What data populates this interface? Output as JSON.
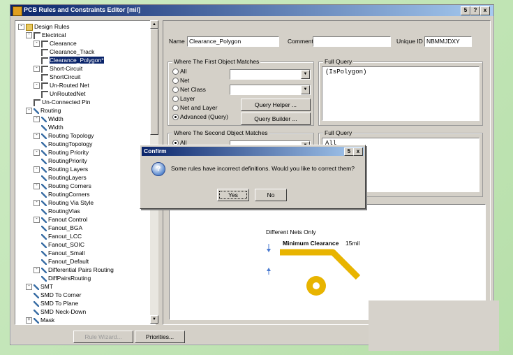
{
  "window": {
    "title": "PCB Rules and Constraints Editor [mil]",
    "btn_help": "?",
    "btn_close": "x",
    "btn_menu": "5"
  },
  "tree": {
    "items": [
      {
        "label": "Design Rules",
        "indent": 0,
        "exp": "-",
        "icon": "folder"
      },
      {
        "label": "Electrical",
        "indent": 1,
        "exp": "-",
        "icon": "rule"
      },
      {
        "label": "Clearance",
        "indent": 2,
        "exp": "-",
        "icon": "rule"
      },
      {
        "label": "Clearance_Track",
        "indent": 3,
        "exp": "",
        "icon": "rule"
      },
      {
        "label": "Clearance_Polygon*",
        "indent": 3,
        "exp": "",
        "icon": "rule",
        "selected": true
      },
      {
        "label": "Short-Circuit",
        "indent": 2,
        "exp": "-",
        "icon": "rule"
      },
      {
        "label": "ShortCircuit",
        "indent": 3,
        "exp": "",
        "icon": "rule"
      },
      {
        "label": "Un-Routed Net",
        "indent": 2,
        "exp": "-",
        "icon": "rule"
      },
      {
        "label": "UnRoutedNet",
        "indent": 3,
        "exp": "",
        "icon": "rule"
      },
      {
        "label": "Un-Connected Pin",
        "indent": 2,
        "exp": "",
        "icon": "rule"
      },
      {
        "label": "Routing",
        "indent": 1,
        "exp": "-",
        "icon": "route"
      },
      {
        "label": "Width",
        "indent": 2,
        "exp": "-",
        "icon": "route"
      },
      {
        "label": "Width",
        "indent": 3,
        "exp": "",
        "icon": "route"
      },
      {
        "label": "Routing Topology",
        "indent": 2,
        "exp": "-",
        "icon": "route"
      },
      {
        "label": "RoutingTopology",
        "indent": 3,
        "exp": "",
        "icon": "route"
      },
      {
        "label": "Routing Priority",
        "indent": 2,
        "exp": "-",
        "icon": "route"
      },
      {
        "label": "RoutingPriority",
        "indent": 3,
        "exp": "",
        "icon": "route"
      },
      {
        "label": "Routing Layers",
        "indent": 2,
        "exp": "-",
        "icon": "route"
      },
      {
        "label": "RoutingLayers",
        "indent": 3,
        "exp": "",
        "icon": "route"
      },
      {
        "label": "Routing Corners",
        "indent": 2,
        "exp": "-",
        "icon": "route"
      },
      {
        "label": "RoutingCorners",
        "indent": 3,
        "exp": "",
        "icon": "route"
      },
      {
        "label": "Routing Via Style",
        "indent": 2,
        "exp": "-",
        "icon": "route"
      },
      {
        "label": "RoutingVias",
        "indent": 3,
        "exp": "",
        "icon": "route"
      },
      {
        "label": "Fanout Control",
        "indent": 2,
        "exp": "-",
        "icon": "route"
      },
      {
        "label": "Fanout_BGA",
        "indent": 3,
        "exp": "",
        "icon": "route"
      },
      {
        "label": "Fanout_LCC",
        "indent": 3,
        "exp": "",
        "icon": "route"
      },
      {
        "label": "Fanout_SOIC",
        "indent": 3,
        "exp": "",
        "icon": "route"
      },
      {
        "label": "Fanout_Small",
        "indent": 3,
        "exp": "",
        "icon": "route"
      },
      {
        "label": "Fanout_Default",
        "indent": 3,
        "exp": "",
        "icon": "route"
      },
      {
        "label": "Differential Pairs Routing",
        "indent": 2,
        "exp": "-",
        "icon": "route"
      },
      {
        "label": "DiffPairsRouting",
        "indent": 3,
        "exp": "",
        "icon": "route"
      },
      {
        "label": "SMT",
        "indent": 1,
        "exp": "-",
        "icon": "route"
      },
      {
        "label": "SMD To Corner",
        "indent": 2,
        "exp": "",
        "icon": "route"
      },
      {
        "label": "SMD To Plane",
        "indent": 2,
        "exp": "",
        "icon": "route"
      },
      {
        "label": "SMD Neck-Down",
        "indent": 2,
        "exp": "",
        "icon": "route"
      },
      {
        "label": "Mask",
        "indent": 1,
        "exp": "+",
        "icon": "route"
      }
    ]
  },
  "rule": {
    "name_label": "Name",
    "name_value": "Clearance_Polygon",
    "comment_label": "Comment",
    "comment_value": "",
    "uid_label": "Unique ID",
    "uid_value": "NBMMJDXY"
  },
  "first": {
    "title": "Where The First Object Matches",
    "options": [
      "All",
      "Net",
      "Net Class",
      "Layer",
      "Net and Layer",
      "Advanced (Query)"
    ],
    "selected": 5,
    "query_helper": "Query Helper ...",
    "query_builder": "Query Builder ...",
    "full_query_title": "Full Query",
    "full_query": "(IsPolygon)"
  },
  "second": {
    "title": "Where The Second Object Matches",
    "option_all": "All",
    "full_query_title": "Full Query",
    "full_query": "All"
  },
  "preview": {
    "caption": "Different Nets Only",
    "label": "Minimum Clearance",
    "value": "15mil"
  },
  "footer": {
    "rule_wizard": "Rule Wizard...",
    "priorities": "Priorities..."
  },
  "dialog": {
    "title": "Confirm",
    "message": "Some rules have incorrect definitions. Would you like to correct them?",
    "yes": "Yes",
    "no": "No",
    "icon_glyph": "?"
  },
  "colors": {
    "trace": "#e8b400",
    "titlebar": "#0a246a",
    "selection": "#0a246a"
  }
}
